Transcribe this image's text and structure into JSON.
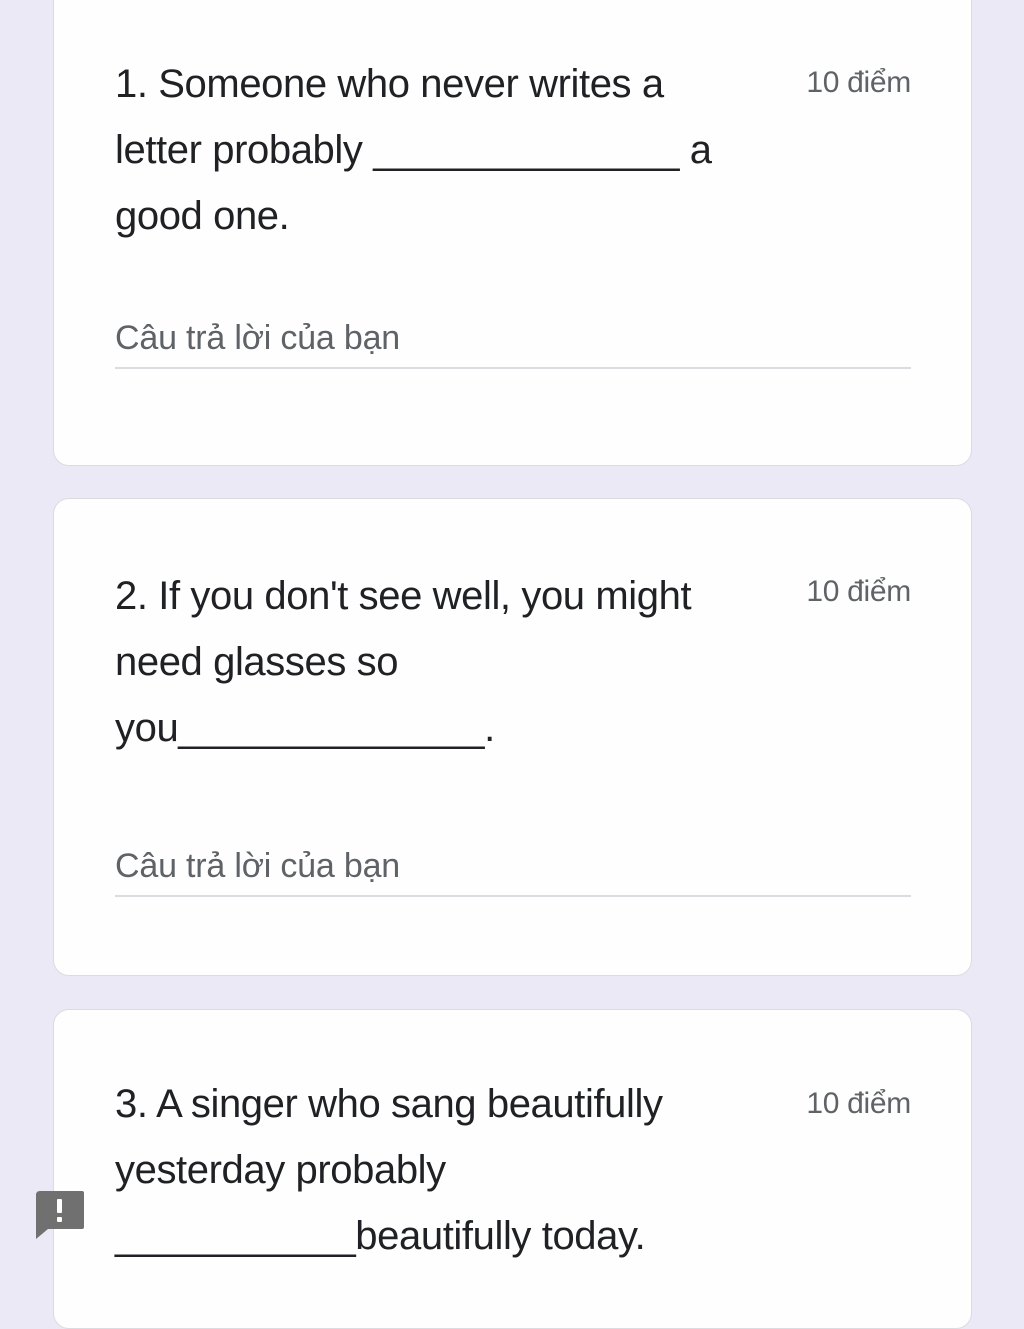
{
  "questions": [
    {
      "line1": "1. Someone who never writes a",
      "line2": "letter probably ______________ a",
      "line3": "good one.",
      "points": "10 điểm",
      "answer_placeholder": "Câu trả lời của bạn"
    },
    {
      "line1": "2. If you don't see well, you might",
      "line2": "need glasses so",
      "line3": "you______________.",
      "points": "10 điểm",
      "answer_placeholder": "Câu trả lời của bạn"
    },
    {
      "line1": "3. A singer who sang beautifully",
      "line2": "yesterday probably",
      "line3": "___________beautifully today.",
      "points": "10 điểm"
    }
  ],
  "report_icon": "exclamation-feedback-icon",
  "colors": {
    "page_background": "#ece9f6",
    "card_background": "#fefefe",
    "primary_text": "#202124",
    "secondary_text": "#5f6368",
    "divider": "#dadce0",
    "report_button": "#707070"
  }
}
